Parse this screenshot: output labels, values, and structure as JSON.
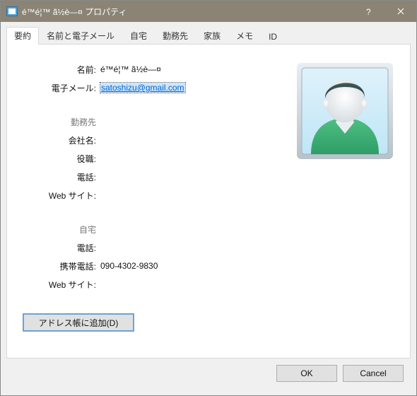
{
  "window": {
    "title": "é™é¦™ ã½è—¤ プロパティ"
  },
  "tabs": [
    {
      "label": "要約"
    },
    {
      "label": "名前と電子メール"
    },
    {
      "label": "自宅"
    },
    {
      "label": "勤務先"
    },
    {
      "label": "家族"
    },
    {
      "label": "メモ"
    },
    {
      "label": "ID"
    }
  ],
  "summary": {
    "name_label": "名前:",
    "name_value": "é™é¦™ ã½è—¤",
    "email_label": "電子メール:",
    "email_value": "satoshizu@gmail.com",
    "work_section": "勤務先",
    "company_label": "会社名:",
    "company_value": "",
    "jobtitle_label": "役職:",
    "jobtitle_value": "",
    "work_phone_label": "電話:",
    "work_phone_value": "",
    "work_web_label": "Web サイト:",
    "work_web_value": "",
    "home_section": "自宅",
    "home_phone_label": "電話:",
    "home_phone_value": "",
    "mobile_label": "携帯電話:",
    "mobile_value": "090-4302-9830",
    "home_web_label": "Web サイト:",
    "home_web_value": ""
  },
  "buttons": {
    "add_to_address_book": "アドレス帳に追加(D)",
    "ok": "OK",
    "cancel": "Cancel"
  }
}
